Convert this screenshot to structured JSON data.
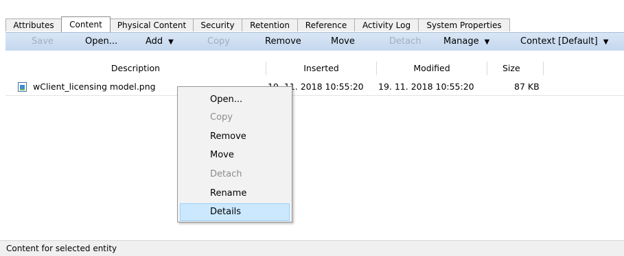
{
  "tabs": [
    {
      "label": "Attributes"
    },
    {
      "label": "Content",
      "active": true
    },
    {
      "label": "Physical Content"
    },
    {
      "label": "Security"
    },
    {
      "label": "Retention"
    },
    {
      "label": "Reference"
    },
    {
      "label": "Activity Log"
    },
    {
      "label": "System Properties"
    }
  ],
  "toolbar": {
    "save": "Save",
    "open": "Open...",
    "add": "Add",
    "copy": "Copy",
    "remove": "Remove",
    "move": "Move",
    "detach": "Detach",
    "manage": "Manage",
    "context": "Context [Default]",
    "dropdown_glyph": "▼"
  },
  "table": {
    "columns": [
      "Description",
      "Inserted",
      "Modified",
      "Size"
    ],
    "rows": [
      {
        "description": "wClient_licensing model.png",
        "inserted": "19. 11. 2018 10:55:20",
        "modified": "19. 11. 2018 10:55:20",
        "size": "87 KB",
        "icon": "image-file-icon"
      }
    ]
  },
  "context_menu": {
    "items": [
      {
        "label": "Open...",
        "enabled": true
      },
      {
        "label": "Copy",
        "enabled": false
      },
      {
        "label": "Remove",
        "enabled": true
      },
      {
        "label": "Move",
        "enabled": true
      },
      {
        "label": "Detach",
        "enabled": false
      },
      {
        "label": "Rename",
        "enabled": true
      },
      {
        "label": "Details",
        "enabled": true,
        "highlighted": true
      }
    ]
  },
  "status_text": "Content for selected entity",
  "colors": {
    "toolbar_top": "#d9e6f5",
    "toolbar_bottom": "#c4d7ee",
    "menu_highlight": "#cce8ff",
    "disabled_text": "#a0aec0"
  }
}
